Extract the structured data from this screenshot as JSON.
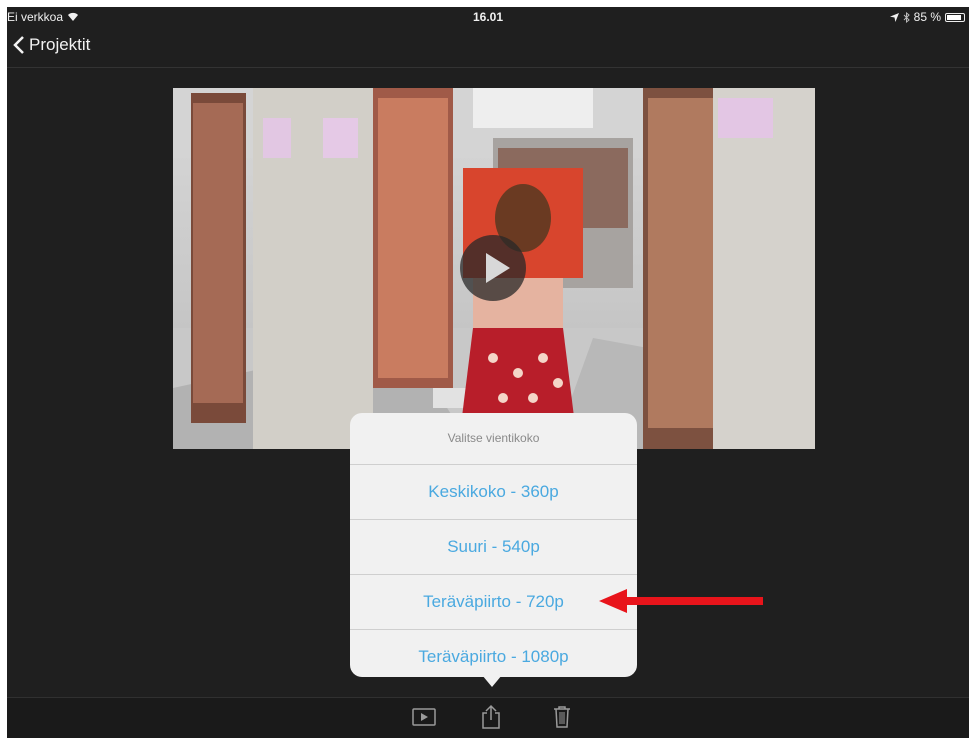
{
  "status_bar": {
    "carrier": "Ei verkkoa",
    "time": "16.01",
    "battery": "85 %",
    "battery_level": 0.85
  },
  "nav": {
    "back_label": "Projektit"
  },
  "popover": {
    "title": "Valitse vientikoko",
    "options": [
      "Keskikoko - 360p",
      "Suuri - 540p",
      "Teräväpiirto - 720p",
      "Teräväpiirto - 1080p"
    ]
  },
  "toolbar": {
    "icons": [
      "play-icon",
      "share-icon",
      "trash-icon"
    ]
  },
  "colors": {
    "accent": "#4aa9e0",
    "annotation": "#e8141b",
    "background": "#1f1f1f"
  }
}
